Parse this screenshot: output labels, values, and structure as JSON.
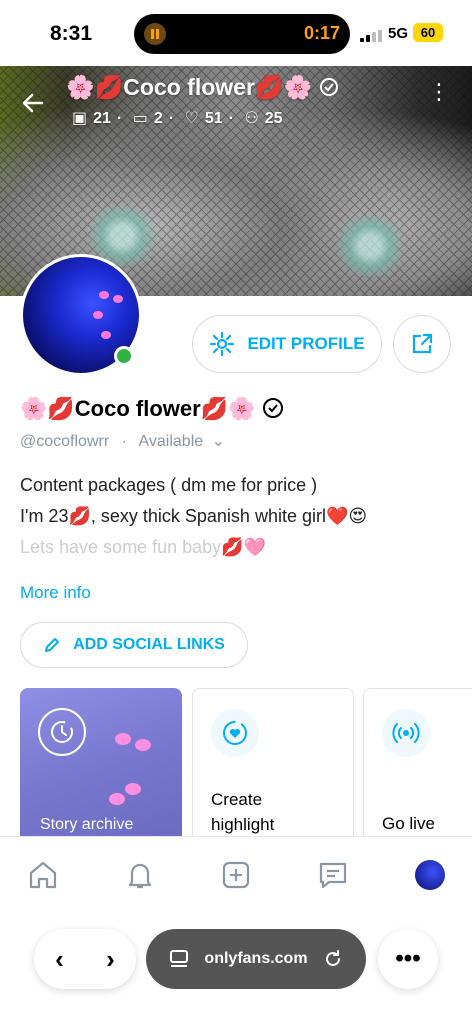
{
  "status_bar": {
    "time": "8:31",
    "recording_time": "0:17",
    "network": "5G",
    "battery": "60"
  },
  "cover": {
    "title": "🌸💋Coco flower💋🌸",
    "stats": {
      "photos": "21",
      "videos": "2",
      "likes": "51",
      "subscribers": "25"
    }
  },
  "profile": {
    "edit_label": "EDIT PROFILE",
    "name": "🌸💋Coco flower💋🌸",
    "handle": "@cocoflowrr",
    "status": "Available",
    "bio_lines": [
      "Content packages ( dm me for price )",
      "I'm 23💋, sexy thick Spanish white girl❤️😍",
      "Lets have some fun baby💋🩷"
    ],
    "more_info": "More info",
    "social_label": "ADD SOCIAL LINKS"
  },
  "cards": {
    "archive": "Story archive",
    "highlight_1": "Create",
    "highlight_2": "highlight",
    "live": "Go live"
  },
  "browser": {
    "url": "onlyfans.com"
  },
  "colors": {
    "accent": "#00aff0",
    "muted": "#8a96a3",
    "online": "#2fb344"
  }
}
